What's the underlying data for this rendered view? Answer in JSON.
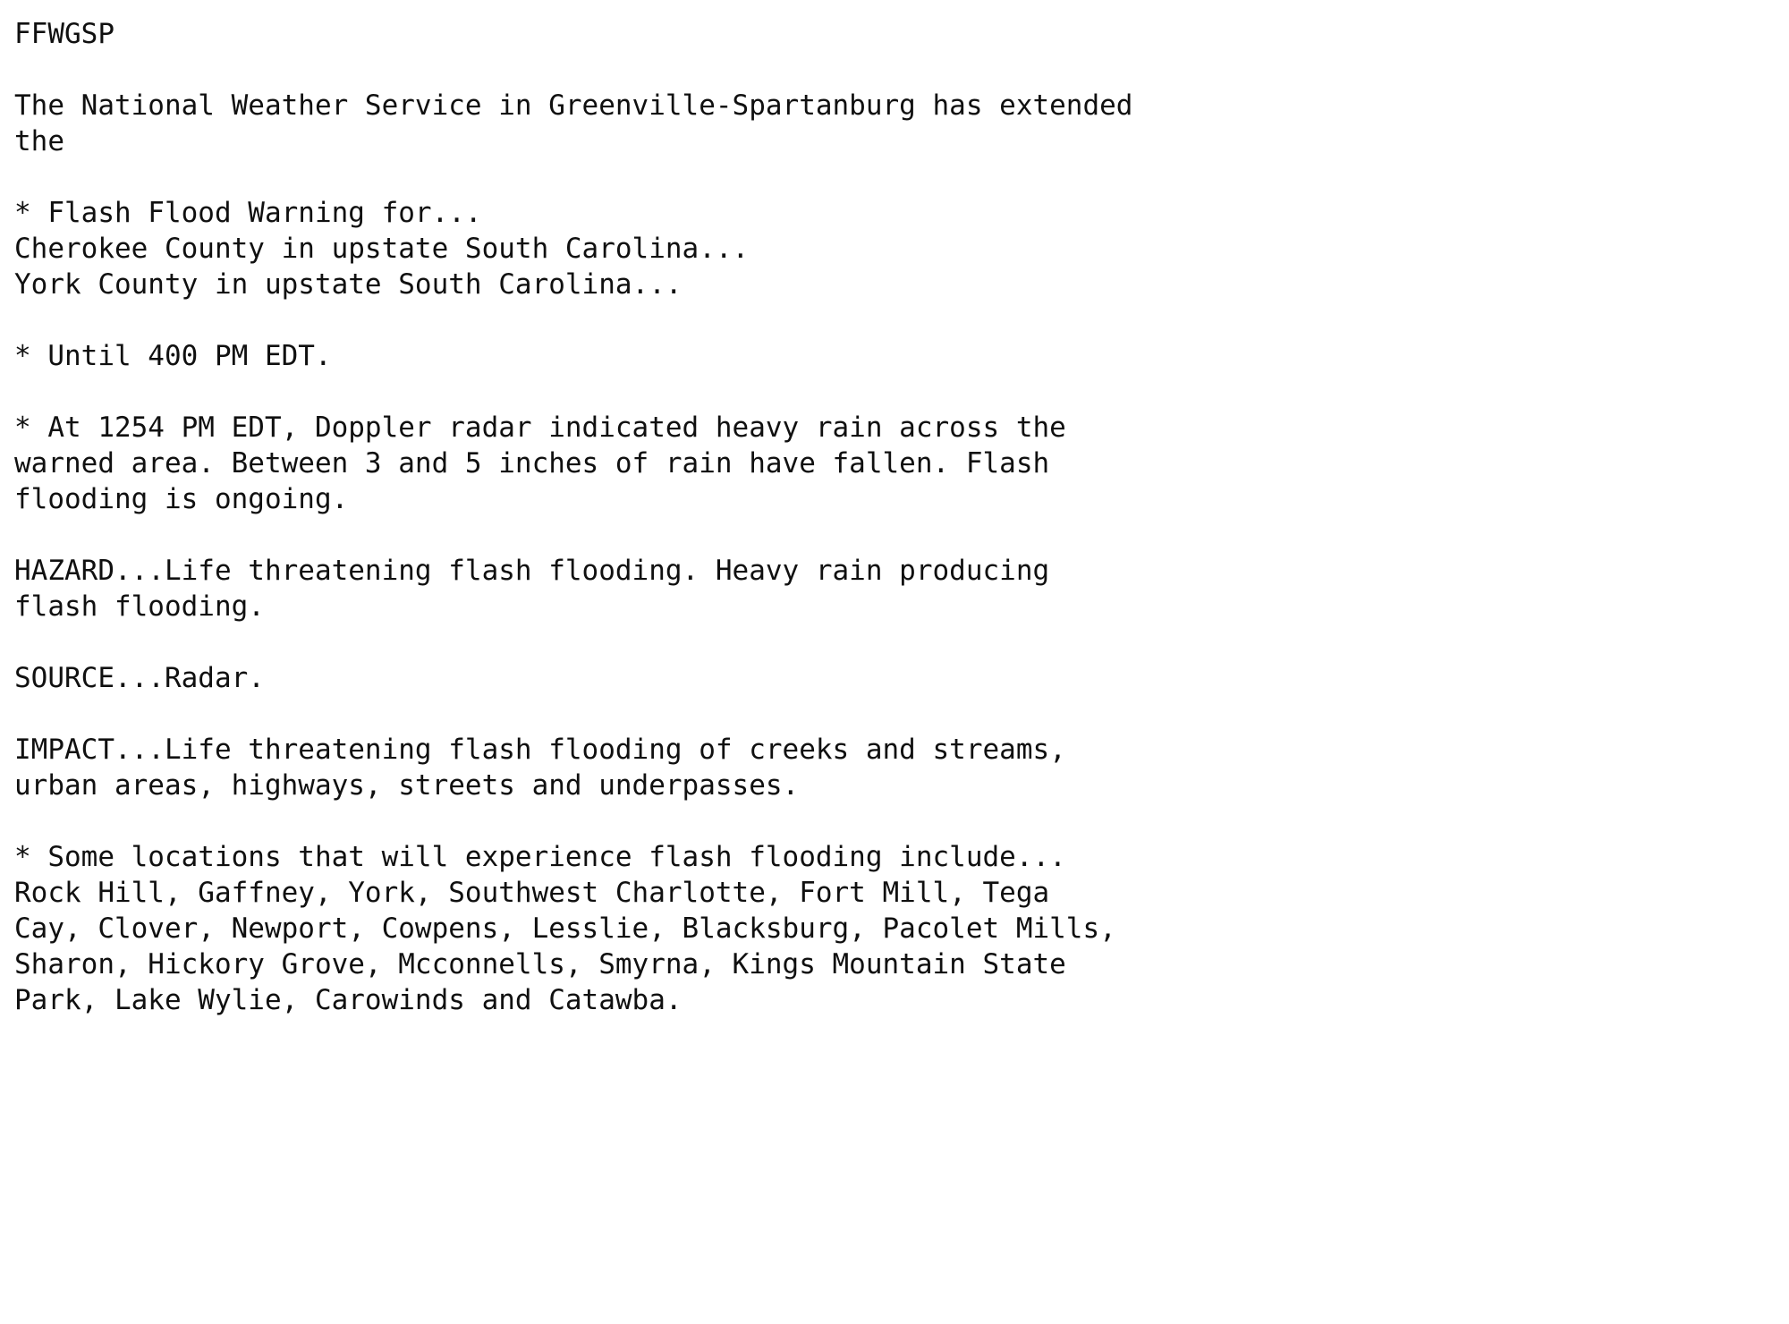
{
  "document": {
    "product_id": "FFWGSP",
    "issuing_office_line_1": "The National Weather Service in Greenville-Spartanburg has extended",
    "issuing_office_line_2": "the",
    "warning_header": "* Flash Flood Warning for...",
    "area_line_1": "Cherokee County in upstate South Carolina...",
    "area_line_2": "York County in upstate South Carolina...",
    "expiration": "* Until 400 PM EDT.",
    "discussion_line_1": "* At 1254 PM EDT, Doppler radar indicated heavy rain across the",
    "discussion_line_2": "warned area. Between 3 and 5 inches of rain have fallen. Flash",
    "discussion_line_3": "flooding is ongoing.",
    "hazard_line_1": "HAZARD...Life threatening flash flooding. Heavy rain producing",
    "hazard_line_2": "flash flooding.",
    "source_line_1": "SOURCE...Radar.",
    "impact_line_1": "IMPACT...Life threatening flash flooding of creeks and streams,",
    "impact_line_2": "urban areas, highways, streets and underpasses.",
    "locations_header": "* Some locations that will experience flash flooding include...",
    "locations_line_1": "Rock Hill, Gaffney, York, Southwest Charlotte, Fort Mill, Tega",
    "locations_line_2": "Cay, Clover, Newport, Cowpens, Lesslie, Blacksburg, Pacolet Mills,",
    "locations_line_3": "Sharon, Hickory Grove, Mcconnells, Smyrna, Kings Mountain State",
    "locations_line_4": "Park, Lake Wylie, Carowinds and Catawba."
  },
  "style": {
    "background_color": "#ffffff",
    "text_color": "#101010"
  }
}
